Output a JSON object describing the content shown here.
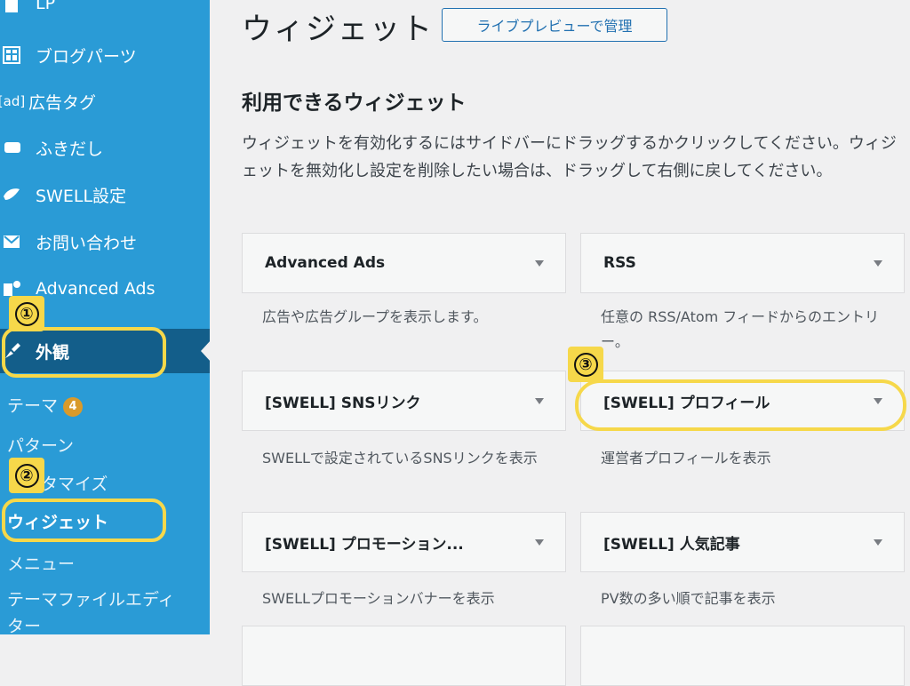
{
  "sidebar": {
    "menu": [
      {
        "label": "LP",
        "icon": "page-icon"
      },
      {
        "label": "ブログパーツ",
        "icon": "grid-icon"
      },
      {
        "label": "広告タグ",
        "icon": "ad-icon",
        "icon_text": "[ad]"
      },
      {
        "label": "ふきだし",
        "icon": "speech-bubble-icon"
      },
      {
        "label": "SWELL設定",
        "icon": "swell-icon"
      },
      {
        "label": "お問い合わせ",
        "icon": "mail-icon"
      },
      {
        "label": "Advanced Ads",
        "icon": "chart-icon"
      },
      {
        "label": "外観",
        "icon": "paintbrush-icon"
      }
    ],
    "submenu": [
      {
        "label": "テーマ",
        "badge": "4"
      },
      {
        "label": "パターン"
      },
      {
        "label": "カスタマイズ"
      },
      {
        "label": "ウィジェット"
      },
      {
        "label": "メニュー"
      },
      {
        "label": "テーマファイルエディター"
      }
    ]
  },
  "header": {
    "title": "ウィジェット",
    "preview_button": "ライブプレビューで管理"
  },
  "available": {
    "heading": "利用できるウィジェット",
    "description": "ウィジェットを有効化するにはサイドバーにドラッグするかクリックしてください。ウィジェットを無効化し設定を削除したい場合は、ドラッグして右側に戻してください。",
    "widgets": [
      {
        "title": "Advanced Ads",
        "desc": "広告や広告グループを表示します。"
      },
      {
        "title": "RSS",
        "desc": "任意の RSS/Atom フィードからのエントリー。"
      },
      {
        "title": "[SWELL] SNSリンク",
        "desc": "SWELLで設定されているSNSリンクを表示"
      },
      {
        "title": "[SWELL] プロフィール",
        "desc": "運営者プロフィールを表示"
      },
      {
        "title": "[SWELL] プロモーション...",
        "desc": "SWELLプロモーションバナーを表示"
      },
      {
        "title": "[SWELL] 人気記事",
        "desc": "PV数の多い順で記事を表示"
      }
    ]
  },
  "annotations": [
    "①",
    "②",
    "③"
  ],
  "colors": {
    "sidebar": "#2a9bd6",
    "sidebar_current": "#135e8a",
    "highlight": "#f6d84a",
    "accent": "#2271b1"
  }
}
